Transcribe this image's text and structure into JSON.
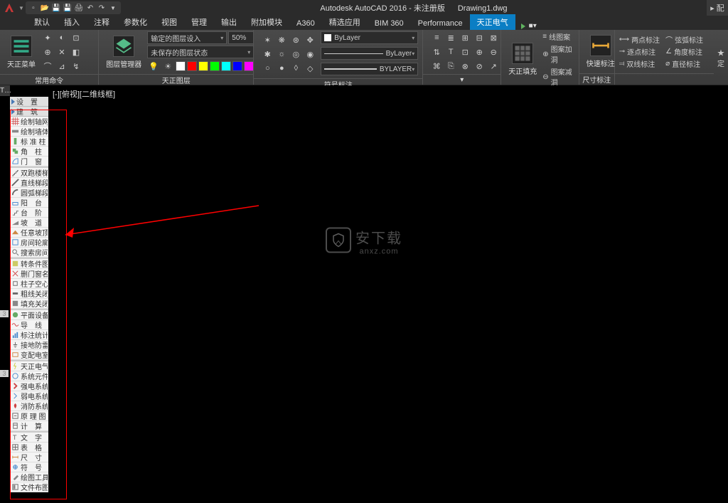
{
  "title": {
    "app": "Autodesk AutoCAD 2016 - 未注册版",
    "file": "Drawing1.dwg"
  },
  "qat": [
    "new",
    "open",
    "save",
    "saveall",
    "plot",
    "undo",
    "redo"
  ],
  "ribbon_tabs": [
    {
      "label": "默认"
    },
    {
      "label": "插入"
    },
    {
      "label": "注释"
    },
    {
      "label": "参数化"
    },
    {
      "label": "视图"
    },
    {
      "label": "管理"
    },
    {
      "label": "输出"
    },
    {
      "label": "附加模块"
    },
    {
      "label": "A360"
    },
    {
      "label": "精选应用"
    },
    {
      "label": "BIM 360"
    },
    {
      "label": "Performance"
    },
    {
      "label": "天正电气",
      "active": true
    }
  ],
  "ribbon_extra": "■▾",
  "right_tab": "▸ 配",
  "panels": {
    "menu": {
      "btn": "天正菜单",
      "label": "常用命令"
    },
    "layer": {
      "btn": "图层管理器",
      "placeholder": "输定的图层设入",
      "pct": "50%",
      "state": "未保存的图层状态",
      "label": "天正图层"
    },
    "props": {
      "color": "ByLayer",
      "ltype": "ByLayer",
      "lweight": "BYLAYER",
      "label": "符号标注"
    },
    "fill": {
      "btn": "天正填充",
      "i1": "线图案",
      "i2": "图案加洞",
      "i3": "图案减洞",
      "label": "天正填充"
    },
    "quick": {
      "btn": "快速标注",
      "label": "尺寸标注"
    },
    "dims": [
      {
        "l": "两点标注"
      },
      {
        "l": "弦弧标注"
      },
      {
        "l": "逐点标注"
      },
      {
        "l": "角度标注"
      },
      {
        "l": "双线标注"
      },
      {
        "l": "直径标注"
      }
    ],
    "custom": "定"
  },
  "left_tab": "T…",
  "view_label": "[-][俯视][二维线框]",
  "palette_headers": [
    {
      "label": "设　置"
    },
    {
      "label": "建　筑",
      "active": true
    }
  ],
  "palette_items": [
    {
      "i": "grid",
      "l": "绘制轴网"
    },
    {
      "i": "wall",
      "l": "绘制墙体"
    },
    {
      "i": "col",
      "l": "标 准 柱"
    },
    {
      "i": "corner",
      "l": "角　柱"
    },
    {
      "i": "door",
      "l": "门　窗"
    },
    {
      "grp": true
    },
    {
      "i": "stair2",
      "l": "双跑楼梯"
    },
    {
      "i": "stairl",
      "l": "直线梯段"
    },
    {
      "i": "stairc",
      "l": "圆弧梯段"
    },
    {
      "i": "balcony",
      "l": "阳　台"
    },
    {
      "i": "step",
      "l": "台　阶"
    },
    {
      "i": "ramp",
      "l": "坡　道"
    },
    {
      "i": "roof",
      "l": "任意坡顶"
    },
    {
      "i": "room",
      "l": "房间轮廓"
    },
    {
      "i": "search",
      "l": "搜索房间"
    },
    {
      "grp": true
    },
    {
      "i": "cond",
      "l": "转条件图"
    },
    {
      "i": "dname",
      "l": "删门窗名"
    },
    {
      "i": "colh",
      "l": "柱子空心"
    },
    {
      "i": "thick",
      "l": "粗线关闭"
    },
    {
      "i": "fill",
      "l": "填充关闭"
    },
    {
      "grp": true
    },
    {
      "i": "plan",
      "l": "平面设备"
    },
    {
      "i": "wire",
      "l": "导　线"
    },
    {
      "i": "stat",
      "l": "标注统计"
    },
    {
      "i": "ground",
      "l": "接地防雷"
    },
    {
      "i": "dist",
      "l": "变配电室"
    },
    {
      "grp": true
    },
    {
      "i": "telec",
      "l": "天正电气"
    },
    {
      "i": "sys",
      "l": "系统元件"
    },
    {
      "i": "strong",
      "l": "强电系统"
    },
    {
      "i": "weak",
      "l": "弱电系统"
    },
    {
      "i": "fire",
      "l": "消防系统"
    },
    {
      "i": "schem",
      "l": "原 理 图"
    },
    {
      "i": "calc",
      "l": "计　算"
    },
    {
      "grp": true
    },
    {
      "i": "text",
      "l": "文　字"
    },
    {
      "i": "table",
      "l": "表　格"
    },
    {
      "i": "dim",
      "l": "尺　寸"
    },
    {
      "i": "sym",
      "l": "符　号"
    },
    {
      "i": "tool",
      "l": "绘图工具"
    },
    {
      "i": "layout",
      "l": "文件布图"
    }
  ],
  "watermark": {
    "brand": "安下载",
    "sub": "anxz.com"
  }
}
